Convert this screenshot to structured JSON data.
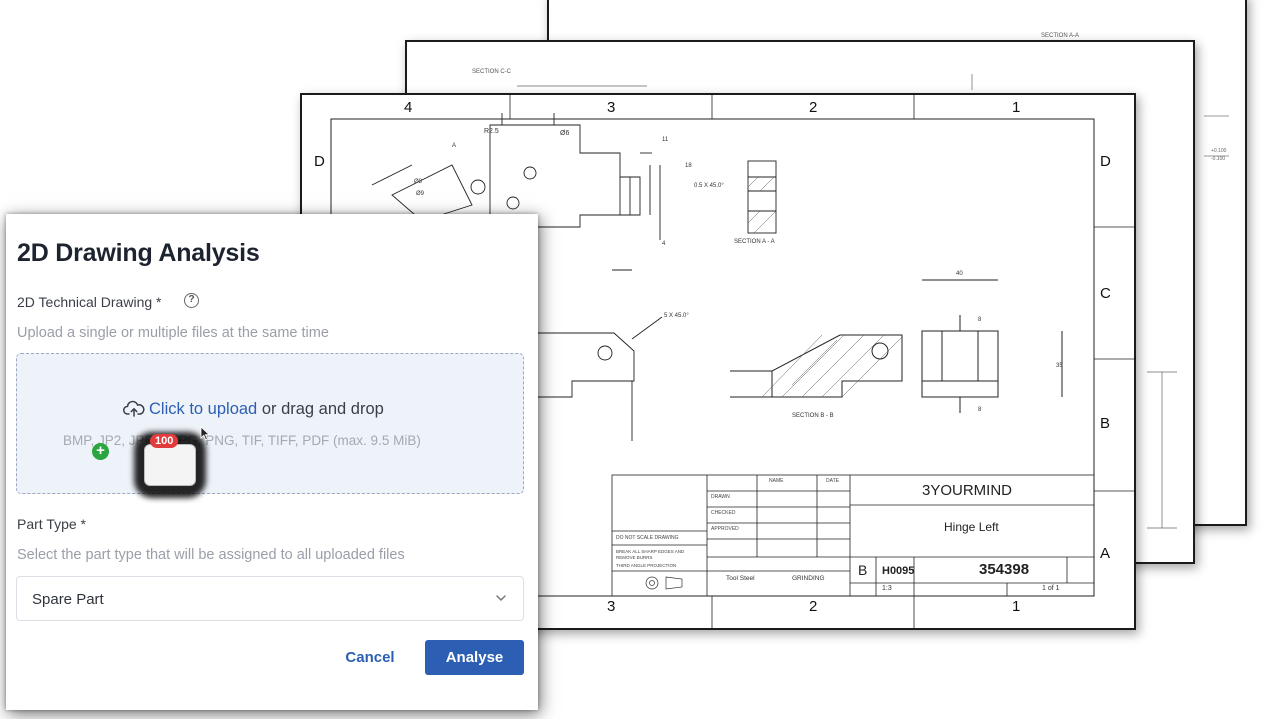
{
  "dialog": {
    "title": "2D Drawing Analysis",
    "drawing_label": "2D Technical Drawing *",
    "info_icon": "?",
    "upload_hint": "Upload a single or multiple files at the same time",
    "dropzone": {
      "click_text": "Click to upload",
      "rest_text": " or drag and drop",
      "formats": "BMP, JP2, JPEG, JPG, PNG, TIF, TIFF, PDF (max. 9.5 MiB)",
      "drag_badge": "100",
      "drag_plus": "+"
    },
    "part_type_label": "Part Type *",
    "part_type_hint": "Select the part type that will be assigned to all uploaded files",
    "part_type_value": "Spare Part",
    "cancel_label": "Cancel",
    "analyse_label": "Analyse",
    "accent_color": "#2c5fb3"
  },
  "drawing": {
    "back_section_label": "SECTION A-A",
    "mid_section_label": "SECTION C-C",
    "front_zones_top": [
      "4",
      "3",
      "2",
      "1"
    ],
    "front_zones_bottom": [
      "3",
      "2",
      "1"
    ],
    "front_zones_right": [
      "D",
      "C",
      "B",
      "A"
    ],
    "front_zone_left": "D",
    "section_aa": "SECTION A - A",
    "section_bb": "SECTION B - B",
    "chamfer_1": "0.5 X 45.0°",
    "chamfer_2": "5 X 45.0°",
    "dims": [
      "R2.5",
      "Ø6",
      "Ø8",
      "Ø9",
      "11",
      "18",
      "4",
      "A",
      "40",
      "8",
      "35"
    ],
    "title_block": {
      "company": "3YOURMIND",
      "title": "Hinge Left",
      "size": "B",
      "cage": "H0095",
      "dwg_no": "354398",
      "scale": "1:3",
      "sheet": "1 of 1",
      "material": "Tool Steel",
      "finish": "GRINDING",
      "headers": [
        "NAME",
        "DATE"
      ],
      "rows": [
        "DRAWN",
        "CHECKED",
        "APPROVED"
      ],
      "notes": [
        "DO NOT SCALE DRAWING",
        "BREAK ALL SHARP EDGES AND REMOVE BURRS",
        "THIRD ANGLE PROJECTION"
      ]
    }
  }
}
